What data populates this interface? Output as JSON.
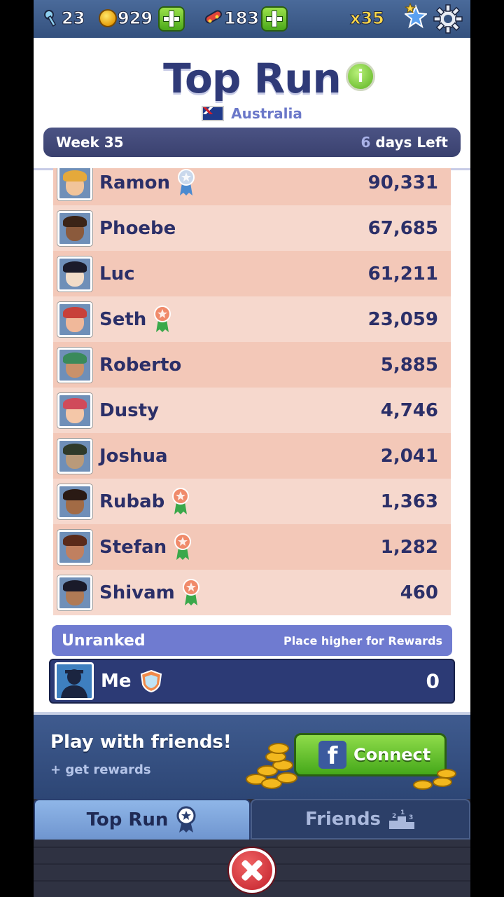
{
  "topbar": {
    "keys": "23",
    "coins": "929",
    "boards": "183",
    "multiplier": "x35"
  },
  "header": {
    "title": "Top Run",
    "info_icon": "i",
    "country": "Australia",
    "week": "Week 35",
    "days_num": "6",
    "days_label": " days Left"
  },
  "leaderboard": [
    {
      "name": "Ramon",
      "score": "90,331",
      "medal": "silver",
      "hair": "#e5a93b",
      "skin": "#f1c49a"
    },
    {
      "name": "Phoebe",
      "score": "67,685",
      "medal": "",
      "hair": "#3b2417",
      "skin": "#8b5a3c"
    },
    {
      "name": "Luc",
      "score": "61,211",
      "medal": "",
      "hair": "#1b1b2a",
      "skin": "#f2dcc8"
    },
    {
      "name": "Seth",
      "score": "23,059",
      "medal": "bronze",
      "hair": "#c8403a",
      "skin": "#f0b89a"
    },
    {
      "name": "Roberto",
      "score": "5,885",
      "medal": "",
      "hair": "#3a8a5a",
      "skin": "#c9916a"
    },
    {
      "name": "Dusty",
      "score": "4,746",
      "medal": "",
      "hair": "#d04a5a",
      "skin": "#f4c7a8"
    },
    {
      "name": "Joshua",
      "score": "2,041",
      "medal": "",
      "hair": "#2f3a2a",
      "skin": "#b99a7a"
    },
    {
      "name": "Rubab",
      "score": "1,363",
      "medal": "bronze",
      "hair": "#2a1a14",
      "skin": "#a26b45"
    },
    {
      "name": "Stefan",
      "score": "1,282",
      "medal": "bronze",
      "hair": "#5a2a1a",
      "skin": "#c08060"
    },
    {
      "name": "Shivam",
      "score": "460",
      "medal": "bronze",
      "hair": "#1a1a2a",
      "skin": "#b07a55"
    }
  ],
  "unranked": {
    "label": "Unranked",
    "hint": "Place higher for Rewards"
  },
  "me": {
    "name": "Me",
    "score": "0"
  },
  "promo": {
    "title": "Play with friends!",
    "subtitle": "+ get rewards",
    "connect_label": "Connect",
    "fb_letter": "f"
  },
  "tabs": {
    "top_run": "Top Run",
    "friends": "Friends"
  },
  "colors": {
    "title": "#2f3a78",
    "row_odd": "#f3c8b8",
    "row_even": "#f6d8cd",
    "accent_green": "#45a81a",
    "unranked_bar": "#6f7bd0",
    "me_row": "#2c3a75"
  }
}
